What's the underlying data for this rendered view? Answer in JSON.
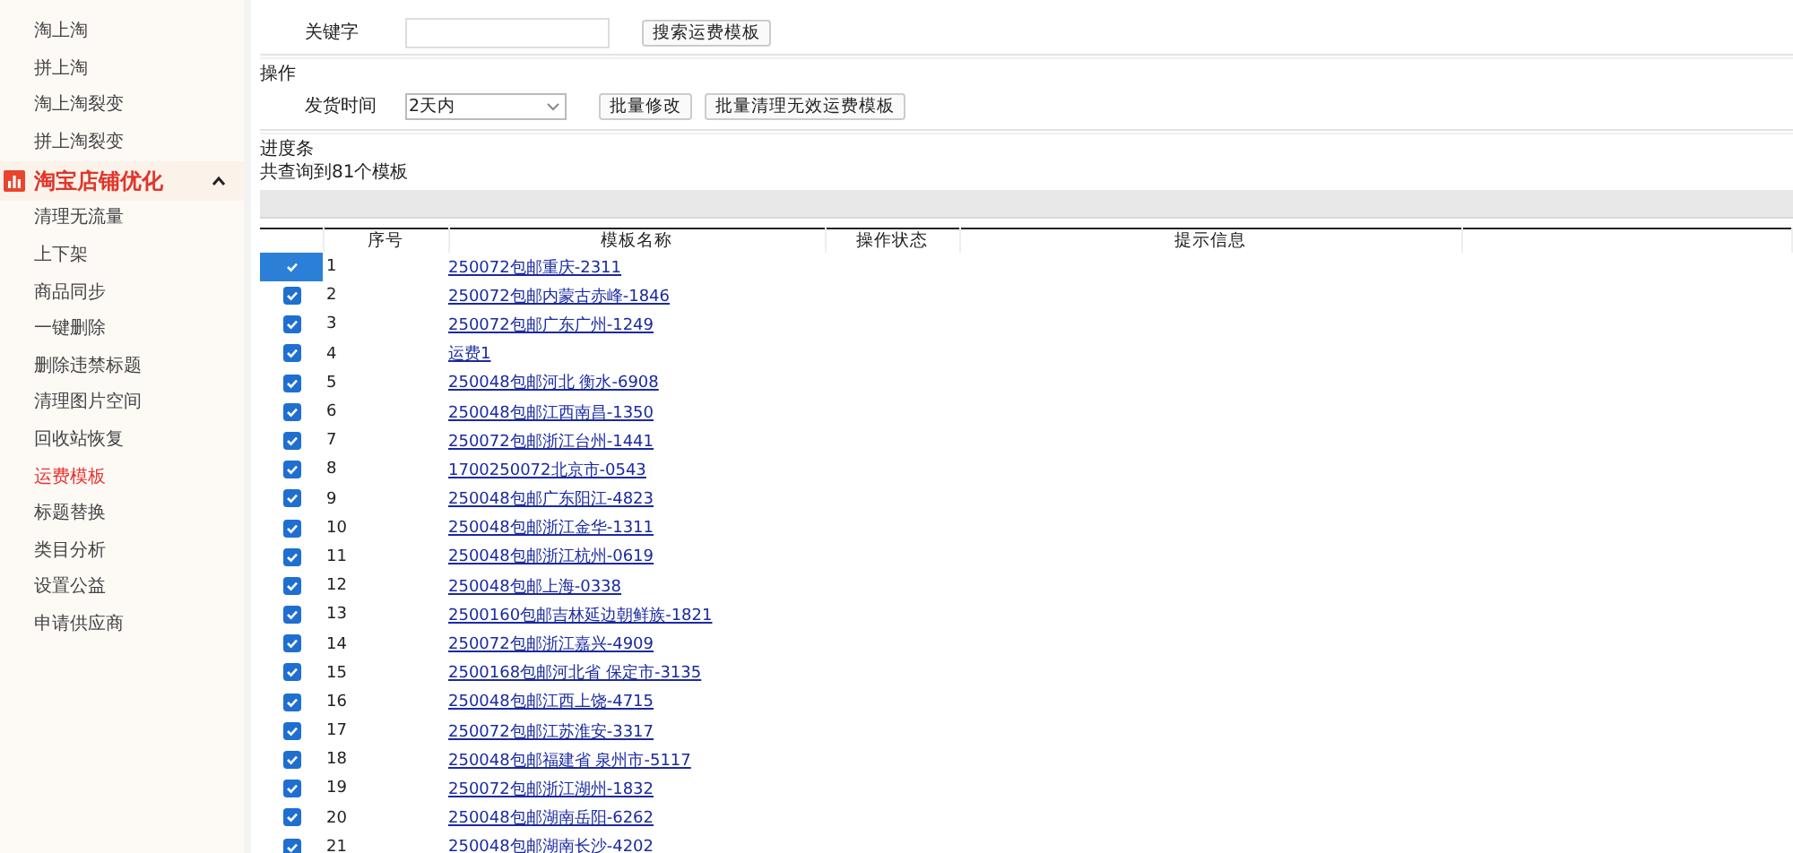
{
  "sidebar": {
    "items": [
      {
        "label": "淘上淘",
        "selected": false
      },
      {
        "label": "拼上淘",
        "selected": false
      },
      {
        "label": "淘上淘裂变",
        "selected": false
      },
      {
        "label": "拼上淘裂变",
        "selected": false
      }
    ],
    "section": {
      "title": "淘宝店铺优化",
      "expanded": true,
      "items": [
        {
          "label": "清理无流量",
          "selected": false
        },
        {
          "label": "上下架",
          "selected": false
        },
        {
          "label": "商品同步",
          "selected": false
        },
        {
          "label": "一键删除",
          "selected": false
        },
        {
          "label": "删除违禁标题",
          "selected": false
        },
        {
          "label": "清理图片空间",
          "selected": false
        },
        {
          "label": "回收站恢复",
          "selected": false
        },
        {
          "label": "运费模板",
          "selected": true
        },
        {
          "label": "标题替换",
          "selected": false
        },
        {
          "label": "类目分析",
          "selected": false
        },
        {
          "label": "设置公益",
          "selected": false
        },
        {
          "label": "申请供应商",
          "selected": false
        }
      ]
    }
  },
  "search": {
    "label": "关键字",
    "button": "搜索运费模板"
  },
  "operations": {
    "title": "操作",
    "label": "发货时间",
    "select_value": "2天内",
    "buttons": [
      "批量修改",
      "批量清理无效运费模板"
    ]
  },
  "progress": {
    "title": "进度条",
    "summary": "共查询到81个模板",
    "level": 0
  },
  "table": {
    "columns": [
      "序号",
      "模板名称",
      "操作状态",
      "提示信息"
    ],
    "rows": [
      {
        "no": "1",
        "name": "250072包邮重庆-2311",
        "checked": true,
        "selected": true
      },
      {
        "no": "2",
        "name": "250072包邮内蒙古赤峰-1846",
        "checked": true,
        "selected": false
      },
      {
        "no": "3",
        "name": "250072包邮广东广州-1249",
        "checked": true,
        "selected": false
      },
      {
        "no": "4",
        "name": "运费1",
        "checked": true,
        "selected": false
      },
      {
        "no": "5",
        "name": "250048包邮河北 衡水-6908",
        "checked": true,
        "selected": false
      },
      {
        "no": "6",
        "name": "250048包邮江西南昌-1350",
        "checked": true,
        "selected": false
      },
      {
        "no": "7",
        "name": "250072包邮浙江台州-1441",
        "checked": true,
        "selected": false
      },
      {
        "no": "8",
        "name": "1700250072北京市-0543",
        "checked": true,
        "selected": false
      },
      {
        "no": "9",
        "name": "250048包邮广东阳江-4823",
        "checked": true,
        "selected": false
      },
      {
        "no": "10",
        "name": "250048包邮浙江金华-1311",
        "checked": true,
        "selected": false
      },
      {
        "no": "11",
        "name": "250048包邮浙江杭州-0619",
        "checked": true,
        "selected": false
      },
      {
        "no": "12",
        "name": "250048包邮上海-0338",
        "checked": true,
        "selected": false
      },
      {
        "no": "13",
        "name": "2500160包邮吉林延边朝鲜族-1821",
        "checked": true,
        "selected": false
      },
      {
        "no": "14",
        "name": "250072包邮浙江嘉兴-4909",
        "checked": true,
        "selected": false
      },
      {
        "no": "15",
        "name": "2500168包邮河北省 保定市-3135",
        "checked": true,
        "selected": false
      },
      {
        "no": "16",
        "name": "250048包邮江西上饶-4715",
        "checked": true,
        "selected": false
      },
      {
        "no": "17",
        "name": "250072包邮江苏淮安-3317",
        "checked": true,
        "selected": false
      },
      {
        "no": "18",
        "name": "250048包邮福建省 泉州市-5117",
        "checked": true,
        "selected": false
      },
      {
        "no": "19",
        "name": "250072包邮浙江湖州-1832",
        "checked": true,
        "selected": false
      },
      {
        "no": "20",
        "name": "250048包邮湖南岳阳-6262",
        "checked": true,
        "selected": false
      },
      {
        "no": "21",
        "name": "250048包邮湖南长沙-4202",
        "checked": true,
        "selected": false
      }
    ]
  }
}
